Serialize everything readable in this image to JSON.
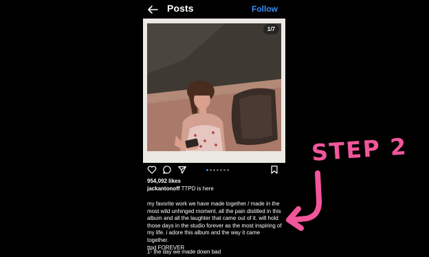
{
  "header": {
    "title": "Posts",
    "follow_label": "Follow"
  },
  "post": {
    "counter": "1/7",
    "likes": "954,092 likes",
    "username": "jackantonoff",
    "caption_first": " TTPD is here",
    "body_lines": [
      "my favorite work we have made together / made in the",
      "most wild unhinged moment. all the pain distilled in this",
      "album and all the laughter that came out of it. will hold",
      "those days in the studio forever as the most inspiring of",
      "my life. i adore this album and the way it came together.",
      "ttpd FOREVER"
    ],
    "track_line": "1- the day we made down bad",
    "carousel": {
      "count": 7,
      "active_index": 0
    }
  },
  "icons": {
    "back": "back-arrow-icon",
    "like": "heart-icon",
    "comment": "comment-icon",
    "share": "send-icon",
    "save": "bookmark-icon"
  },
  "annotation": {
    "text": "STEP 2",
    "color": "#f2569a"
  },
  "colors": {
    "accent": "#3a8ef7",
    "background": "#000000"
  }
}
